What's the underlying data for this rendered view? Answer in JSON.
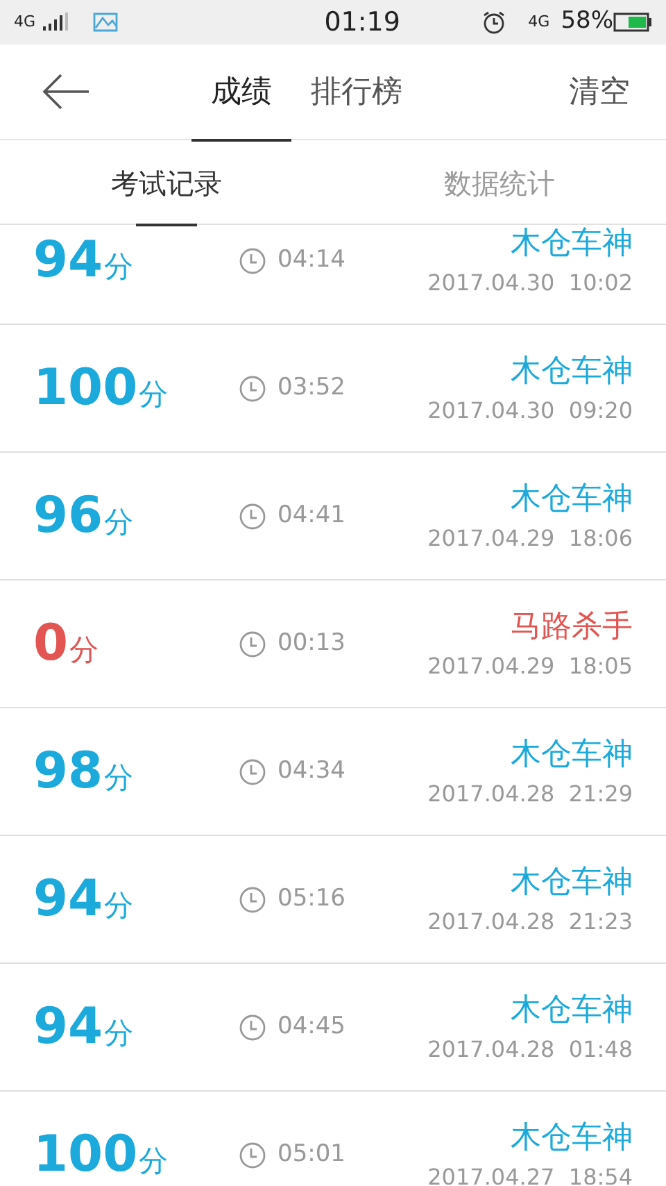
{
  "status_bar": {
    "network": "4G",
    "time": "01:19",
    "data_network": "4G",
    "battery": "58%"
  },
  "header": {
    "tabs": [
      {
        "label": "成绩",
        "selected": true
      },
      {
        "label": "排行榜",
        "selected": false
      }
    ],
    "action": "清空"
  },
  "sub_tabs": [
    {
      "label": "考试记录",
      "selected": true
    },
    {
      "label": "数据统计",
      "selected": false
    }
  ],
  "records": [
    {
      "score": "94",
      "unit": "分",
      "duration": "04:14",
      "title": "木仓车神",
      "date": "2017.04.30  10:02",
      "passed": true
    },
    {
      "score": "100",
      "unit": "分",
      "duration": "03:52",
      "title": "木仓车神",
      "date": "2017.04.30  09:20",
      "passed": true
    },
    {
      "score": "96",
      "unit": "分",
      "duration": "04:41",
      "title": "木仓车神",
      "date": "2017.04.29  18:06",
      "passed": true
    },
    {
      "score": "0",
      "unit": "分",
      "duration": "00:13",
      "title": "马路杀手",
      "date": "2017.04.29  18:05",
      "passed": false
    },
    {
      "score": "98",
      "unit": "分",
      "duration": "04:34",
      "title": "木仓车神",
      "date": "2017.04.28  21:29",
      "passed": true
    },
    {
      "score": "94",
      "unit": "分",
      "duration": "05:16",
      "title": "木仓车神",
      "date": "2017.04.28  21:23",
      "passed": true
    },
    {
      "score": "94",
      "unit": "分",
      "duration": "04:45",
      "title": "木仓车神",
      "date": "2017.04.28  01:48",
      "passed": true
    },
    {
      "score": "100",
      "unit": "分",
      "duration": "05:01",
      "title": "木仓车神",
      "date": "2017.04.27  18:54",
      "passed": true
    }
  ]
}
